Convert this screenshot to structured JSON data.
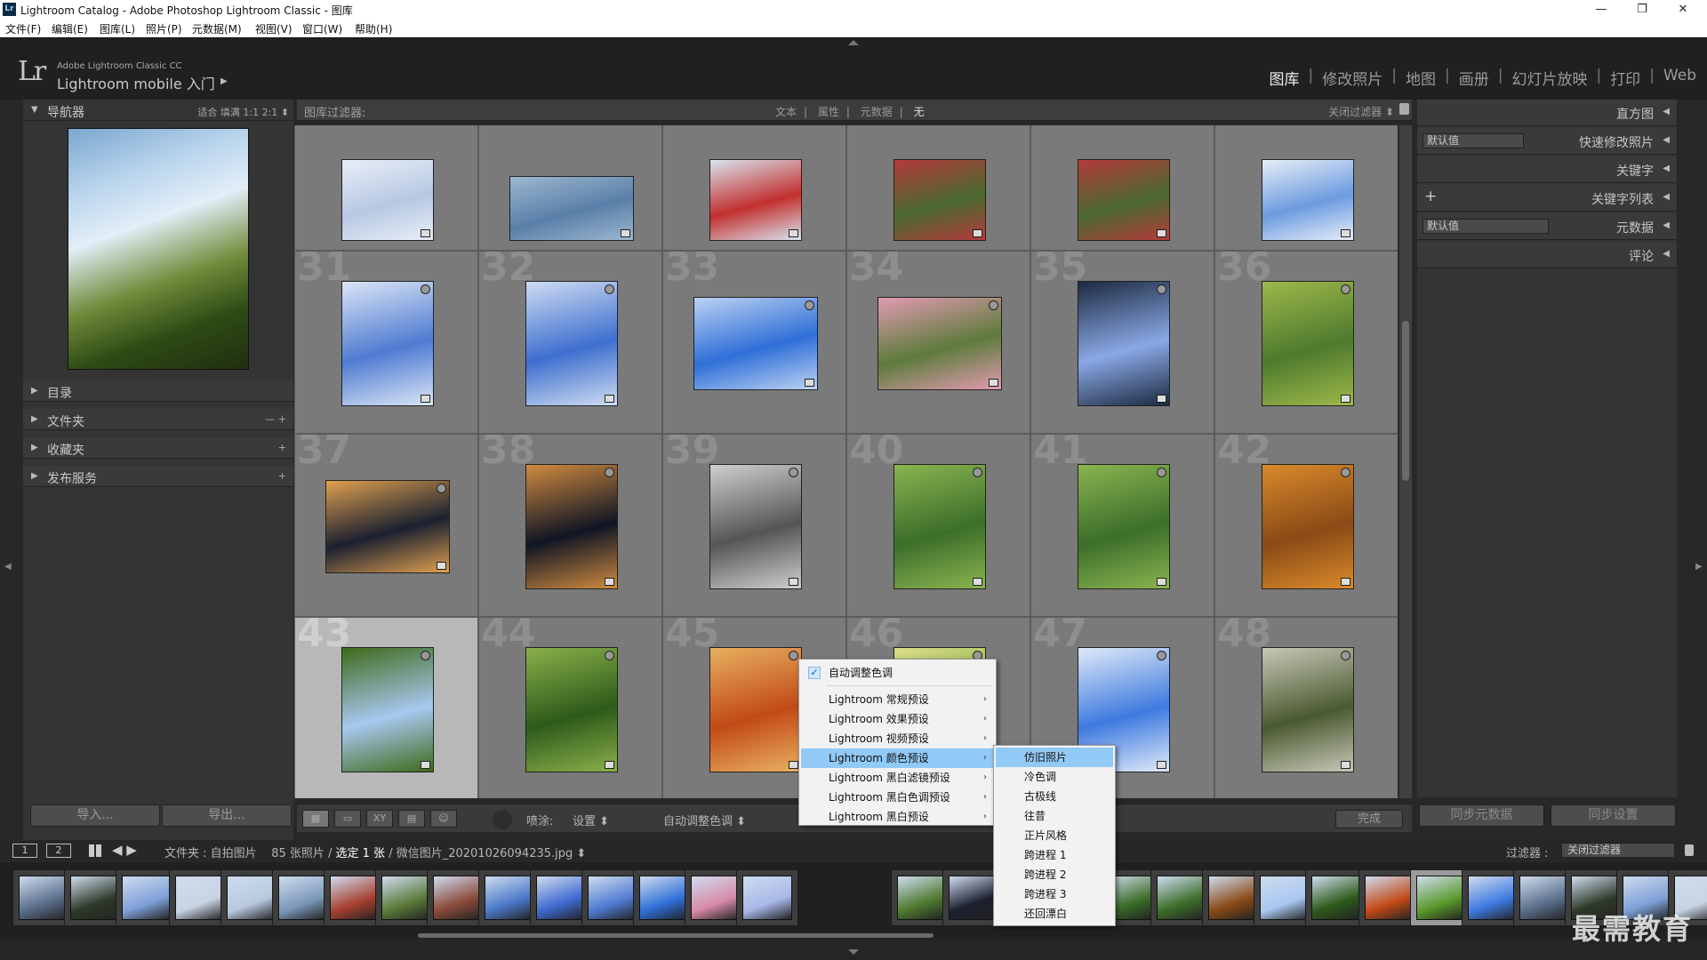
{
  "window": {
    "title": "Lightroom Catalog - Adobe Photoshop Lightroom Classic - 图库",
    "icon": "Lr",
    "minimize": "—",
    "restore": "❐",
    "close": "✕"
  },
  "menu": [
    "文件(F)",
    "编辑(E)",
    "图库(L)",
    "照片(P)",
    "元数据(M)",
    "视图(V)",
    "窗口(W)",
    "帮助(H)"
  ],
  "identity": {
    "logo": "Lr",
    "product": "Adobe Lightroom Classic CC",
    "mobile": "Lightroom mobile 入门",
    "arrow": "▶"
  },
  "modules": [
    "图库",
    "修改照片",
    "地图",
    "画册",
    "幻灯片放映",
    "打印",
    "Web"
  ],
  "active_module": "图库",
  "navigator": {
    "title": "导航器",
    "options": "适合   填满   1:1   2:1 ⬍"
  },
  "left_panels": [
    {
      "label": "目录",
      "ops": ""
    },
    {
      "label": "文件夹",
      "ops": "—  +"
    },
    {
      "label": "收藏夹",
      "ops": "+"
    },
    {
      "label": "发布服务",
      "ops": "+"
    }
  ],
  "left_buttons": {
    "import": "导入...",
    "export": "导出..."
  },
  "filter_bar": {
    "label": "图库过滤器:",
    "options": [
      "文本",
      "属性",
      "元数据",
      "无"
    ],
    "active": "无",
    "right": "关闭过滤器 ⬍"
  },
  "grid": {
    "rows": [
      {
        "numbers": [
          "",
          "",
          "",
          "",
          "",
          ""
        ]
      },
      {
        "numbers": [
          "31",
          "32",
          "33",
          "34",
          "35",
          "36"
        ]
      },
      {
        "numbers": [
          "37",
          "38",
          "39",
          "40",
          "41",
          "42"
        ]
      },
      {
        "numbers": [
          "43",
          "44",
          "45",
          "46",
          "47",
          "48"
        ]
      }
    ],
    "selected_index": 18
  },
  "toolbar": {
    "spray_label": "喷涂:",
    "spray_value": "设置 ⬍",
    "auto_label": "自动调整色调 ⬍",
    "done": "完成"
  },
  "right_panels": [
    {
      "label": "直方图",
      "select": "",
      "plus": false
    },
    {
      "label": "快速修改照片",
      "select": "默认值",
      "plus": false
    },
    {
      "label": "关键字",
      "select": "",
      "plus": false
    },
    {
      "label": "关键字列表",
      "select": "",
      "plus": true
    },
    {
      "label": "元数据",
      "select": "默认值",
      "plus": false
    },
    {
      "label": "评论",
      "select": "",
      "plus": false
    }
  ],
  "right_buttons": {
    "sync_meta": "同步元数据",
    "sync_settings": "同步设置"
  },
  "filmstrip": {
    "page1": "1",
    "page2": "2",
    "arrows": "◀  ▶",
    "folder_prefix": "文件夹 : 自拍图片",
    "count": "85 张照片 /",
    "selected": "选定 1 张",
    "filename": "/ 微信图片_20201026094235.jpg ⬍",
    "filter_label": "过滤器 :",
    "filter_value": "关闭过滤器"
  },
  "context_menu": {
    "checked_item": "自动调整色调",
    "items": [
      {
        "label": "Lightroom 常规预设",
        "highlight": false
      },
      {
        "label": "Lightroom 效果预设",
        "highlight": false
      },
      {
        "label": "Lightroom 视频预设",
        "highlight": false
      },
      {
        "label": "Lightroom 颜色预设",
        "highlight": true
      },
      {
        "label": "Lightroom 黑白滤镜预设",
        "highlight": false
      },
      {
        "label": "Lightroom 黑白色调预设",
        "highlight": false
      },
      {
        "label": "Lightroom 黑白预设",
        "highlight": false
      }
    ],
    "submenu_arrow": "›"
  },
  "submenu": {
    "items": [
      {
        "label": "仿旧照片",
        "highlight": true
      },
      {
        "label": "冷色调",
        "highlight": false
      },
      {
        "label": "古极线",
        "highlight": false
      },
      {
        "label": "往昔",
        "highlight": false
      },
      {
        "label": "正片风格",
        "highlight": false
      },
      {
        "label": "跨进程 1",
        "highlight": false
      },
      {
        "label": "跨进程 2",
        "highlight": false
      },
      {
        "label": "跨进程 3",
        "highlight": false
      },
      {
        "label": "还回漂白",
        "highlight": false
      }
    ]
  },
  "watermark": "最需教育"
}
